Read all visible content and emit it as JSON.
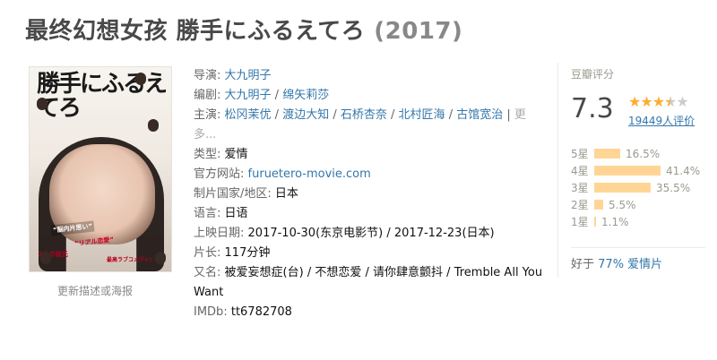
{
  "title": {
    "main": "最终幻想女孩 勝手にふるえてろ",
    "year": "(2017)"
  },
  "poster": {
    "alt_title": "勝手にふるえてろ",
    "tags": [
      "“脳内片思い”",
      "“リアル恋愛”",
      "2人の彼氏",
      "最高ラブコメディ!"
    ]
  },
  "update_link": "更新描述或海报",
  "info": {
    "director_label": "导演",
    "director": [
      "大九明子"
    ],
    "writer_label": "编剧",
    "writers": [
      "大九明子",
      "绵矢莉莎"
    ],
    "cast_label": "主演",
    "cast": [
      "松冈茉优",
      "渡边大知",
      "石桥杏奈",
      "北村匠海",
      "古馆宽治"
    ],
    "cast_more": "更多...",
    "genre_label": "类型:",
    "genre": "爱情",
    "site_label": "官方网站:",
    "site": "furuetero-movie.com",
    "country_label": "制片国家/地区:",
    "country": "日本",
    "language_label": "语言:",
    "language": "日语",
    "release_label": "上映日期:",
    "release_dates": [
      "2017-10-30(东京电影节)",
      "2017-12-23(日本)"
    ],
    "runtime_label": "片长:",
    "runtime": "117分钟",
    "aka_label": "又名:",
    "aka": [
      "被爱妄想症(台)",
      "不想恋爱",
      "请你肆意颤抖",
      "Tremble All You Want"
    ],
    "imdb_label": "IMDb:",
    "imdb": "tt6782708"
  },
  "rating": {
    "title": "豆瓣评分",
    "score": "7.3",
    "votes": "19449人评价",
    "star_fraction": 0.73,
    "bars": [
      {
        "label": "5星",
        "percent": 16.5,
        "text": "16.5%"
      },
      {
        "label": "4星",
        "percent": 41.4,
        "text": "41.4%"
      },
      {
        "label": "3星",
        "percent": 35.5,
        "text": "35.5%"
      },
      {
        "label": "2星",
        "percent": 5.5,
        "text": "5.5%"
      },
      {
        "label": "1星",
        "percent": 1.1,
        "text": "1.1%"
      }
    ],
    "better_prefix": "好于",
    "better_link": "77% 爱情片"
  },
  "colors": {
    "link": "#3377aa",
    "star": "#ffac2d",
    "bar": "#ffd596",
    "title": "#494949"
  }
}
